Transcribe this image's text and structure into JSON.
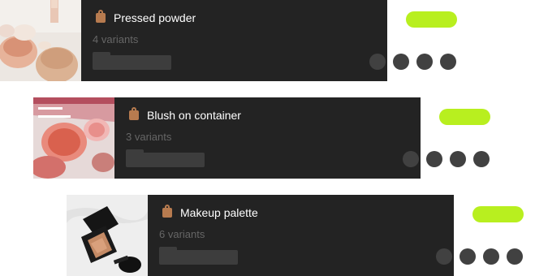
{
  "colors": {
    "card_background": "#232323",
    "title_text": "#ffffff",
    "variants_text": "#666666",
    "status_pill": "#b8ef1f",
    "bag_icon": "#b77b4f",
    "placeholder": "#3d3d3d",
    "dot": "#414141"
  },
  "products": [
    {
      "name": "Pressed powder",
      "variants": "4 variants",
      "icon": "shopping-bag-icon",
      "thumbnail": "loose-powder-jars-photo"
    },
    {
      "name": "Blush on container",
      "variants": "3 variants",
      "icon": "shopping-bag-icon",
      "thumbnail": "blush-compacts-magazine-photo"
    },
    {
      "name": "Makeup palette",
      "variants": "6 variants",
      "icon": "shopping-bag-icon",
      "thumbnail": "makeup-palette-brush-photo"
    }
  ]
}
